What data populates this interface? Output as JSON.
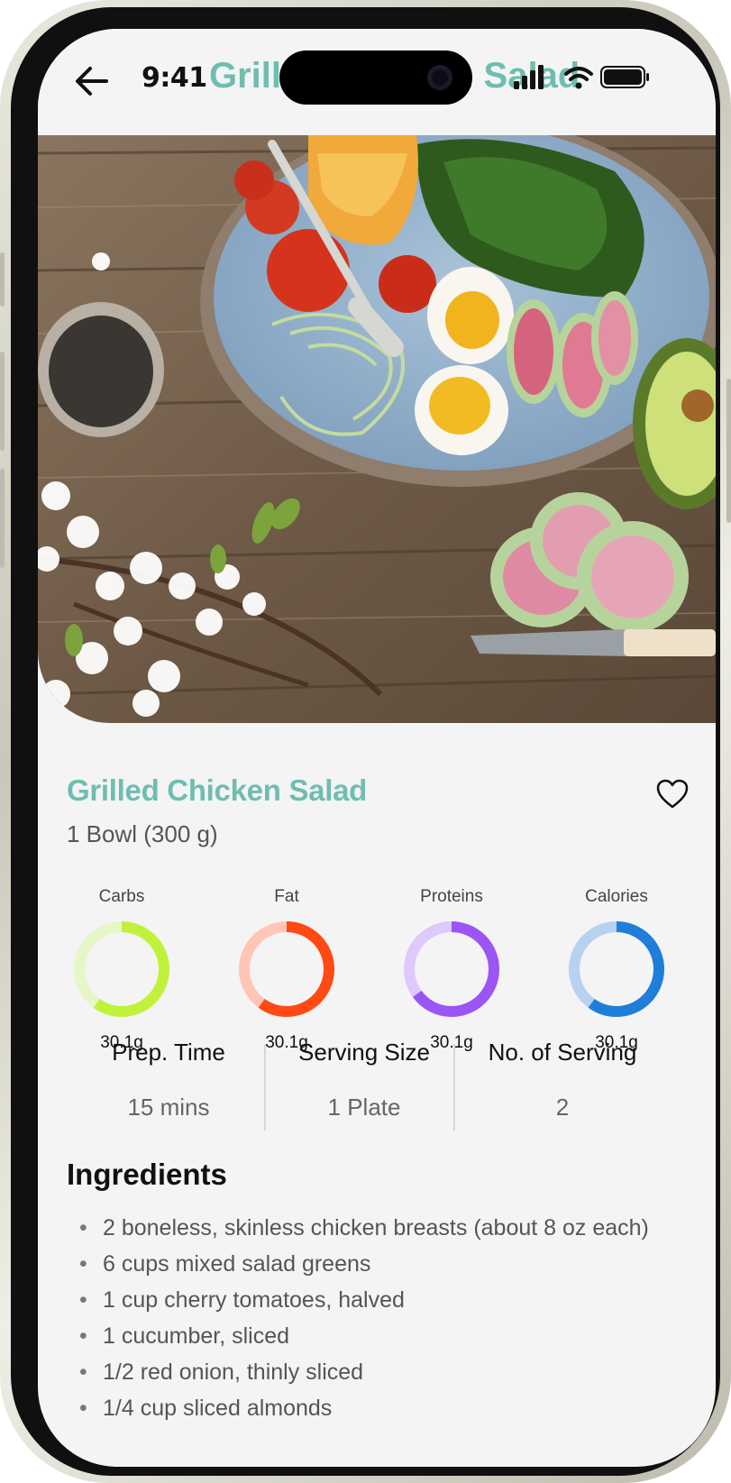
{
  "status_bar": {
    "time": "9:41"
  },
  "nav": {
    "title": "Grilled Chicken Salad"
  },
  "recipe": {
    "title": "Grilled Chicken Salad",
    "portion": "1 Bowl (300 g)"
  },
  "macros": [
    {
      "label": "Carbs",
      "value": "30.1g",
      "fill": 0.6,
      "color": "#c1f23b",
      "track": "#e6f7c7"
    },
    {
      "label": "Fat",
      "value": "30.1g",
      "fill": 0.6,
      "color": "#ff4a14",
      "track": "#ffc6b6"
    },
    {
      "label": "Proteins",
      "value": "30.1g",
      "fill": 0.65,
      "color": "#9b55f5",
      "track": "#dfc8fb"
    },
    {
      "label": "Calories",
      "value": "30.1g",
      "fill": 0.6,
      "color": "#1f7ed9",
      "track": "#b7d2f0"
    }
  ],
  "stats": [
    {
      "label": "Prep. Time",
      "value": "15 mins"
    },
    {
      "label": "Serving Size",
      "value": "1 Plate"
    },
    {
      "label": "No. of Serving",
      "value": "2"
    }
  ],
  "ingredients": {
    "heading": "Ingredients",
    "items": [
      "2 boneless, skinless chicken breasts (about 8 oz each)",
      "6 cups mixed salad greens",
      "1 cup cherry tomatoes, halved",
      "1 cucumber, sliced",
      "1/2 red onion, thinly sliced",
      "1/4 cup sliced almonds"
    ]
  },
  "colors": {
    "accent": "#6fbdb1"
  },
  "icons": [
    "back-arrow-icon",
    "signal-icon",
    "wifi-icon",
    "battery-icon",
    "heart-icon"
  ]
}
